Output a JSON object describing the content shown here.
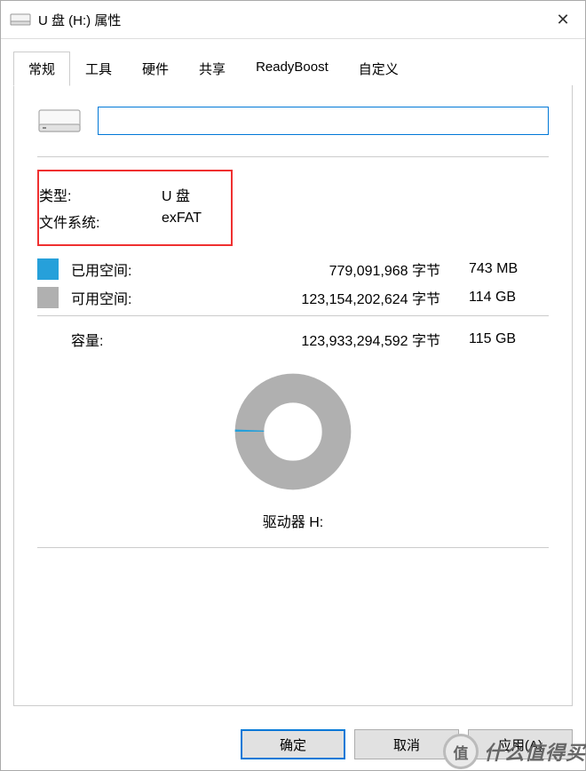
{
  "window": {
    "title": "U 盘 (H:) 属性",
    "close_glyph": "✕"
  },
  "tabs": [
    {
      "label": "常规",
      "active": true
    },
    {
      "label": "工具",
      "active": false
    },
    {
      "label": "硬件",
      "active": false
    },
    {
      "label": "共享",
      "active": false
    },
    {
      "label": "ReadyBoost",
      "active": false
    },
    {
      "label": "自定义",
      "active": false
    }
  ],
  "details": {
    "name_value": "",
    "type_label": "类型:",
    "type_value": "U 盘",
    "filesystem_label": "文件系统:",
    "filesystem_value": "exFAT"
  },
  "usage": {
    "used_label": "已用空间:",
    "used_bytes": "779,091,968 字节",
    "used_human": "743 MB",
    "free_label": "可用空间:",
    "free_bytes": "123,154,202,624 字节",
    "free_human": "114 GB",
    "capacity_label": "容量:",
    "capacity_bytes": "123,933,294,592 字节",
    "capacity_human": "115 GB",
    "drive_label": "驱动器 H:"
  },
  "colors": {
    "used": "#26a0da",
    "free": "#b0b0b0"
  },
  "chart_data": {
    "type": "pie",
    "title": "驱动器 H:",
    "series": [
      {
        "name": "已用空间",
        "value": 779091968,
        "color": "#26a0da"
      },
      {
        "name": "可用空间",
        "value": 123154202624,
        "color": "#b0b0b0"
      }
    ],
    "used_fraction": 0.00629
  },
  "buttons": {
    "ok": "确定",
    "cancel": "取消",
    "apply": "应用(A)"
  },
  "watermark": {
    "badge": "值",
    "text": "什么值得买"
  }
}
